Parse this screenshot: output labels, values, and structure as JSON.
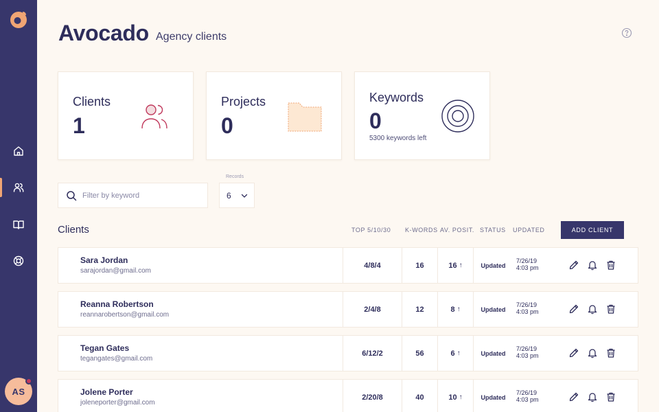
{
  "app": {
    "title": "Avocado",
    "subtitle": "Agency clients",
    "avatar_initials": "AS"
  },
  "colors": {
    "sidebar": "#37366b",
    "accent": "#f0a574",
    "background": "#fdf8f2",
    "text": "#2e2d5b"
  },
  "sidebar": {
    "items": [
      {
        "name": "home",
        "icon": "home-icon",
        "active": false
      },
      {
        "name": "clients",
        "icon": "users-icon",
        "active": true
      },
      {
        "name": "docs",
        "icon": "book-icon",
        "active": false
      },
      {
        "name": "support",
        "icon": "lifebuoy-icon",
        "active": false
      }
    ]
  },
  "cards": {
    "clients": {
      "label": "Clients",
      "value": "1",
      "icon": "users-icon"
    },
    "projects": {
      "label": "Projects",
      "value": "0",
      "icon": "folder-icon"
    },
    "keywords": {
      "label": "Keywords",
      "value": "0",
      "sub": "5300 keywords left",
      "icon": "target-icon"
    }
  },
  "filters": {
    "search_placeholder": "Filter by keyword",
    "records_label": "Records",
    "records_value": "6"
  },
  "table": {
    "title": "Clients",
    "headers": {
      "top": "TOP 5/10/30",
      "kwords": "K-WORDS",
      "avposit": "AV. POSIT.",
      "status": "STATUS",
      "updated": "UPDATED"
    },
    "add_button": "ADD CLIENT",
    "rows": [
      {
        "name": "Sara Jordan",
        "email": "sarajordan@gmail.com",
        "top": "4/8/4",
        "kwords": "16",
        "avpos": "16",
        "status": "Updated",
        "date": "7/26/19",
        "time": "4:03 pm"
      },
      {
        "name": "Reanna Robertson",
        "email": "reannarobertson@gmail.com",
        "top": "2/4/8",
        "kwords": "12",
        "avpos": "8",
        "status": "Updated",
        "date": "7/26/19",
        "time": "4:03 pm"
      },
      {
        "name": "Tegan Gates",
        "email": "tegangates@gmail.com",
        "top": "6/12/2",
        "kwords": "56",
        "avpos": "6",
        "status": "Updated",
        "date": "7/26/19",
        "time": "4:03 pm"
      },
      {
        "name": "Jolene Porter",
        "email": "joleneporter@gmail.com",
        "top": "2/20/8",
        "kwords": "40",
        "avpos": "10",
        "status": "Updated",
        "date": "7/26/19",
        "time": "4:03 pm"
      }
    ]
  }
}
